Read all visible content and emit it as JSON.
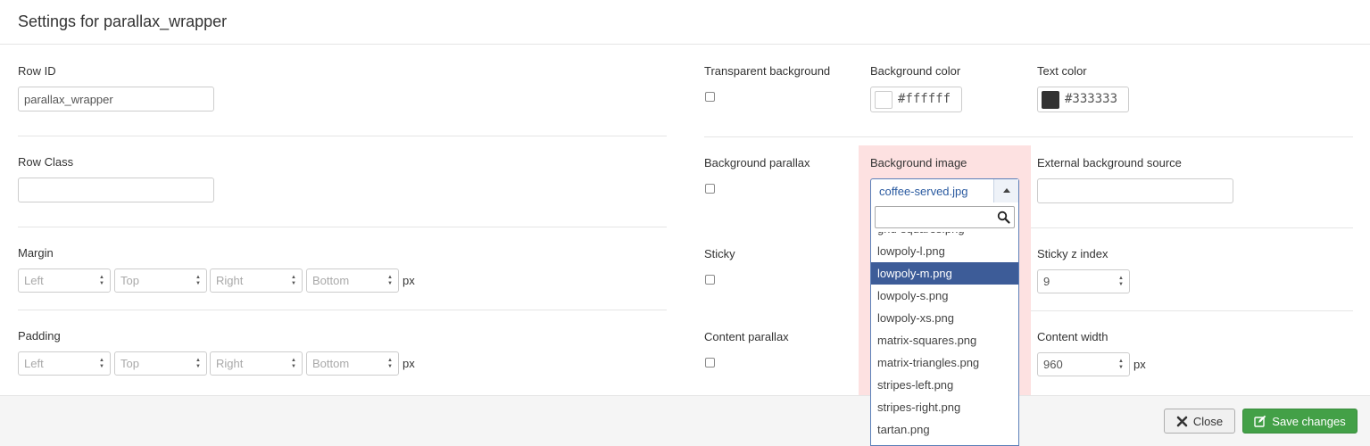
{
  "modal": {
    "title": "Settings for parallax_wrapper"
  },
  "left": {
    "row_id": {
      "label": "Row ID",
      "value": "parallax_wrapper"
    },
    "row_class": {
      "label": "Row Class",
      "value": ""
    },
    "margin": {
      "label": "Margin",
      "placeholders": [
        "Left",
        "Top",
        "Right",
        "Bottom"
      ],
      "unit": "px"
    },
    "padding": {
      "label": "Padding",
      "placeholders": [
        "Left",
        "Top",
        "Right",
        "Bottom"
      ],
      "unit": "px"
    }
  },
  "right": {
    "transparent_background": {
      "label": "Transparent background",
      "checked": false
    },
    "background_color": {
      "label": "Background color",
      "value": "#ffffff",
      "swatch": "#ffffff"
    },
    "text_color": {
      "label": "Text color",
      "value": "#333333",
      "swatch": "#333333"
    },
    "background_parallax": {
      "label": "Background parallax",
      "checked": false
    },
    "background_image": {
      "label": "Background image",
      "selected": "coffee-served.jpg",
      "search_value": "",
      "options": [
        "grid-squares.png",
        "lowpoly-l.png",
        "lowpoly-m.png",
        "lowpoly-s.png",
        "lowpoly-xs.png",
        "matrix-squares.png",
        "matrix-triangles.png",
        "stripes-left.png",
        "stripes-right.png",
        "tartan.png"
      ],
      "highlighted": "lowpoly-m.png"
    },
    "external_background_source": {
      "label": "External background source",
      "value": ""
    },
    "sticky": {
      "label": "Sticky",
      "checked": false
    },
    "sticky_z_index": {
      "label": "Sticky z index",
      "value": "9"
    },
    "content_parallax": {
      "label": "Content parallax",
      "checked": false
    },
    "content_width": {
      "label": "Content width",
      "value": "960",
      "unit": "px"
    }
  },
  "footer": {
    "close_label": "Close",
    "save_label": "Save changes"
  },
  "colors": {
    "highlight": "#fde1e1",
    "selected_option": "#3d5c98",
    "save_button": "#43a047"
  }
}
